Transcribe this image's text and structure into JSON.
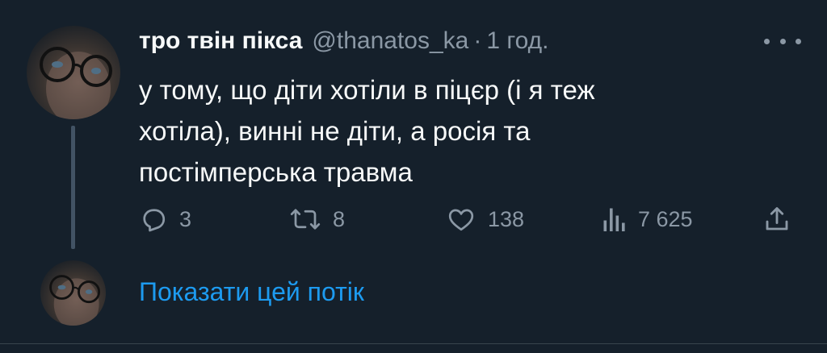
{
  "tweet": {
    "display_name": "тро твін пікса",
    "handle": "@thanatos_ka",
    "separator": "·",
    "time": "1 год.",
    "text_lines": [
      "у тому, що діти хотіли в піцєр (і я теж",
      "хотіла), винні не діти, а росія та",
      "постімперська травма"
    ],
    "actions": {
      "reply": {
        "icon": "reply-icon",
        "count": "3"
      },
      "retweet": {
        "icon": "retweet-icon",
        "count": "8"
      },
      "like": {
        "icon": "heart-icon",
        "count": "138"
      },
      "views": {
        "icon": "views-icon",
        "count": "7 625"
      },
      "share": {
        "icon": "share-icon"
      }
    }
  },
  "thread": {
    "show_label": "Показати цей потік"
  },
  "colors": {
    "background": "#15202b",
    "text": "#f7f9f9",
    "secondary": "#8b98a5",
    "link": "#1d9bf0"
  }
}
